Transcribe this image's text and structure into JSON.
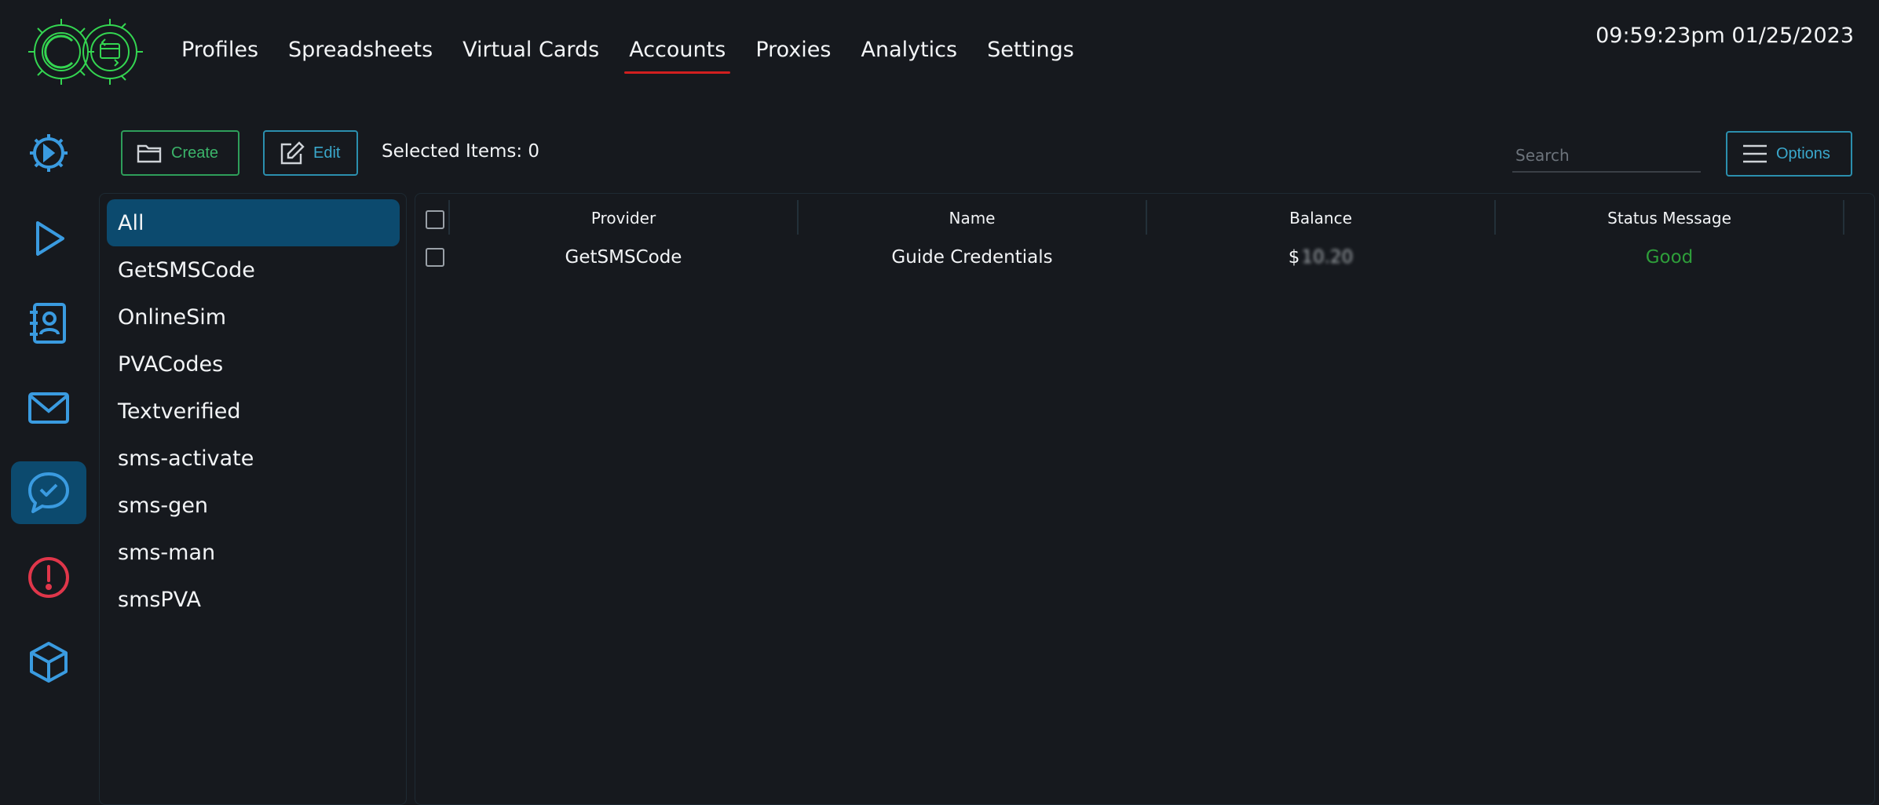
{
  "nav": {
    "items": [
      {
        "label": "Profiles",
        "active": false
      },
      {
        "label": "Spreadsheets",
        "active": false
      },
      {
        "label": "Virtual Cards",
        "active": false
      },
      {
        "label": "Accounts",
        "active": true
      },
      {
        "label": "Proxies",
        "active": false
      },
      {
        "label": "Analytics",
        "active": false
      },
      {
        "label": "Settings",
        "active": false
      }
    ]
  },
  "clock": "09:59:23pm 01/25/2023",
  "sidebar": {
    "items": [
      {
        "icon": "gear-play-icon",
        "active": false
      },
      {
        "icon": "play-icon",
        "active": false
      },
      {
        "icon": "contact-book-icon",
        "active": false
      },
      {
        "icon": "mail-icon",
        "active": false
      },
      {
        "icon": "chat-check-icon",
        "active": true
      },
      {
        "icon": "alert-circle-icon",
        "active": false
      },
      {
        "icon": "cube-icon",
        "active": false
      }
    ]
  },
  "toolbar": {
    "create_label": "Create",
    "edit_label": "Edit",
    "selected_label": "Selected Items: 0",
    "search_placeholder": "Search",
    "options_label": "Options"
  },
  "categories": [
    "All",
    "GetSMSCode",
    "OnlineSim",
    "PVACodes",
    "Textverified",
    "sms-activate",
    "sms-gen",
    "sms-man",
    "smsPVA"
  ],
  "table": {
    "columns": [
      "Provider",
      "Name",
      "Balance",
      "Status Message"
    ],
    "rows": [
      {
        "provider": "GetSMSCode",
        "name": "Guide Credentials",
        "balance_prefix": "$",
        "balance_value": "10.20",
        "status": "Good"
      }
    ]
  },
  "colors": {
    "accent": "#0c4a6e",
    "nav_underline": "#d21f1f",
    "create": "#3bb46a",
    "edit": "#3aa8cc",
    "status_good": "#2e9e3a",
    "sidebar_icon": "#3a9be0",
    "alert_icon": "#e0364a",
    "logo": "#34d651"
  }
}
